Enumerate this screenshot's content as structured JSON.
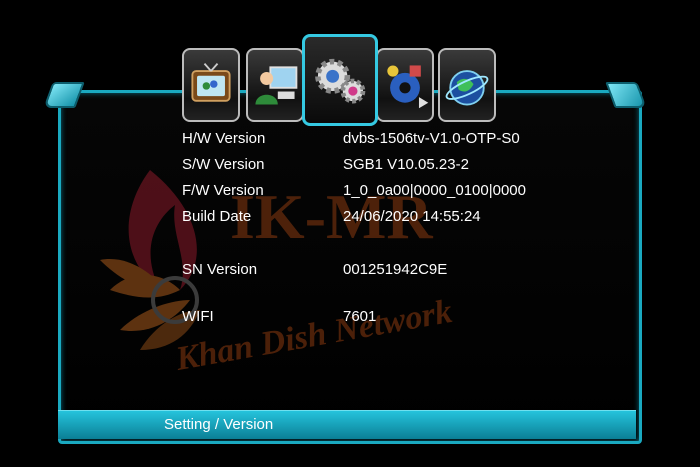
{
  "menu": {
    "tabs": [
      {
        "icon": "tv-icon",
        "active": false
      },
      {
        "icon": "user-computer-icon",
        "active": false
      },
      {
        "icon": "settings-gears-icon",
        "active": true
      },
      {
        "icon": "media-icon",
        "active": false
      },
      {
        "icon": "globe-icon",
        "active": false
      }
    ]
  },
  "info": {
    "hw": {
      "label": "H/W Version",
      "value": "dvbs-1506tv-V1.0-OTP-S0"
    },
    "sw": {
      "label": "S/W Version",
      "value": "SGB1 V10.05.23-2"
    },
    "fw": {
      "label": "F/W Version",
      "value": "1_0_0a00|0000_0100|0000"
    },
    "build": {
      "label": "Build Date",
      "value": "24/06/2020 14:55:24"
    },
    "sn": {
      "label": "SN Version",
      "value": "001251942C9E"
    },
    "wifi": {
      "label": "WIFI",
      "value": "7601"
    }
  },
  "watermark": {
    "line1": "IK-MR",
    "line2": "Khan Dish Network"
  },
  "status_bar": {
    "breadcrumb": "Setting / Version"
  },
  "colors": {
    "accent": "#1aa9c0",
    "text": "#ffffff",
    "background": "#000000"
  }
}
